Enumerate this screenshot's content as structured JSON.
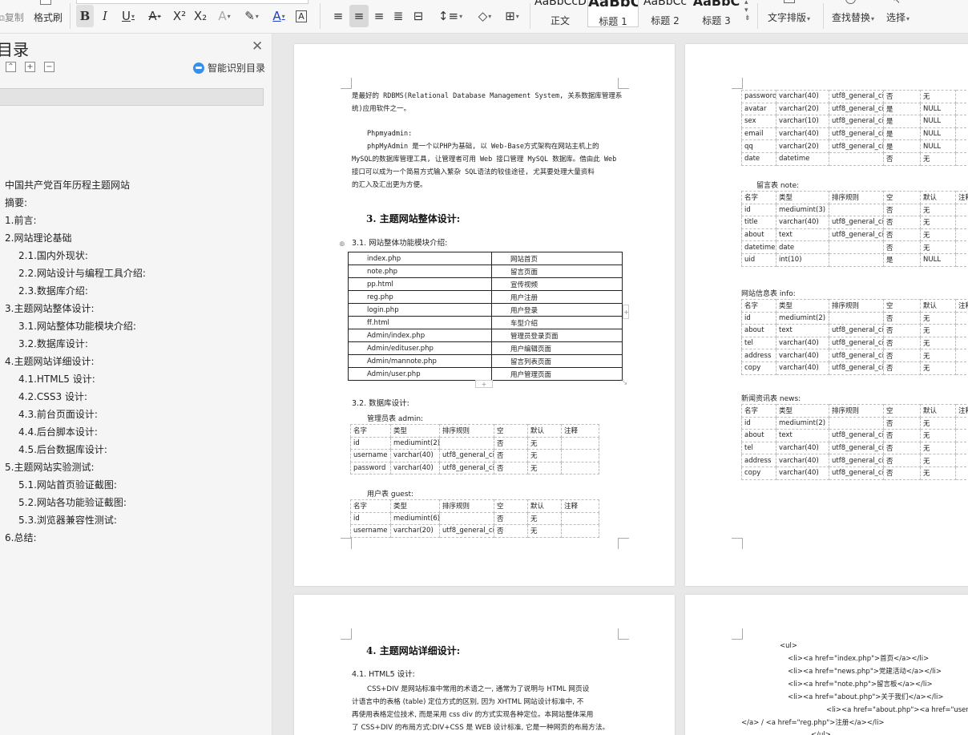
{
  "ribbon": {
    "copy": "复制",
    "format_painter": "格式刷",
    "styles": [
      {
        "preview": "AaBbCcD",
        "label": "正文"
      },
      {
        "preview": "AaBbC",
        "label": "标题 1"
      },
      {
        "preview": "AaBbCc",
        "label": "标题 2"
      },
      {
        "preview": "AaBbC",
        "label": "标题 3"
      }
    ],
    "text_layout": "文字排版",
    "find_replace": "查找替换",
    "select": "选择"
  },
  "sidebar": {
    "title": "目录",
    "smart_toc": "智能识别目录",
    "items": [
      {
        "text": "中国共产党百年历程主题网站",
        "level": 1
      },
      {
        "text": "摘要:",
        "level": 1
      },
      {
        "text": "1.前言:",
        "level": 1
      },
      {
        "text": "2.网站理论基础",
        "level": 1
      },
      {
        "text": "2.1.国内外现状:",
        "level": 2
      },
      {
        "text": "2.2.网站设计与编程工具介绍:",
        "level": 2
      },
      {
        "text": "2.3.数据库介绍:",
        "level": 2
      },
      {
        "text": "3.主题网站整体设计:",
        "level": 1
      },
      {
        "text": "3.1.网站整体功能模块介绍:",
        "level": 2
      },
      {
        "text": "3.2.数据库设计:",
        "level": 2
      },
      {
        "text": "4.主题网站详细设计:",
        "level": 1
      },
      {
        "text": "4.1.HTML5 设计:",
        "level": 2
      },
      {
        "text": "4.2.CSS3 设计:",
        "level": 2
      },
      {
        "text": "4.3.前台页面设计:",
        "level": 2
      },
      {
        "text": "4.4.后台脚本设计:",
        "level": 2
      },
      {
        "text": "4.5.后台数据库设计:",
        "level": 2
      },
      {
        "text": "5.主题网站实验测试:",
        "level": 1
      },
      {
        "text": "5.1.网站首页验证截图:",
        "level": 2
      },
      {
        "text": "5.2.网站各功能验证截图:",
        "level": 2
      },
      {
        "text": "5.3.浏览器兼容性测试:",
        "level": 2
      },
      {
        "text": "6.总结:",
        "level": 1
      }
    ]
  },
  "page1": {
    "intro_line1": "是最好的 RDBMS(Relational Database Management System, 关系数据库管理系",
    "intro_line2": "统)应用软件之一。",
    "pma_title": "Phpmyadmin:",
    "pma_line1": "phpMyAdmin 是一个以PHP为基础, 以 Web-Base方式架构在网站主机上的",
    "pma_line2": "MySQL的数据库管理工具, 让管理者可用 Web 接口管理 MySQL 数据库。借由此 Web",
    "pma_line3": "接口可以成为一个简易方式输入繁杂 SQL语法的较佳途径, 尤其要处理大量资料",
    "pma_line4": "的汇入及汇出更为方便。",
    "h_design": "3. 主题网站整体设计:",
    "h_modules": "3.1.    网站整体功能模块介绍:",
    "modules": [
      [
        "index.php",
        "网站首页"
      ],
      [
        "note.php",
        "留言页面"
      ],
      [
        "pp.html",
        "宣传视频"
      ],
      [
        "reg.php",
        "用户注册"
      ],
      [
        "login.php",
        "用户登录"
      ],
      [
        "ff.html",
        "车型介绍"
      ],
      [
        "Admin/index.php",
        "管理员登录页面"
      ],
      [
        "Admin/edituser.php",
        "用户编辑页面"
      ],
      [
        "Admin/mannote.php",
        "留言列表页面"
      ],
      [
        "Admin/user.php",
        "用户管理页面"
      ]
    ],
    "h_db": "3.2.    数据库设计:",
    "cap_admin": "管理员表 admin:",
    "admin_table": [
      [
        "名字",
        "类型",
        "排序规则",
        "空",
        "默认",
        "注释"
      ],
      [
        "id",
        "mediumint(2)",
        "",
        "否",
        "无",
        ""
      ],
      [
        "username",
        "varchar(40)",
        "utf8_general_ci",
        "否",
        "无",
        ""
      ],
      [
        "password",
        "varchar(40)",
        "utf8_general_ci",
        "否",
        "无",
        ""
      ]
    ],
    "cap_guest": "用户表 guest:",
    "guest_table": [
      [
        "名字",
        "类型",
        "排序规则",
        "空",
        "默认",
        "注释"
      ],
      [
        "id",
        "mediumint(6)",
        "",
        "否",
        "无",
        ""
      ],
      [
        "username",
        "varchar(20)",
        "utf8_general_ci",
        "否",
        "无",
        ""
      ]
    ]
  },
  "page2": {
    "guest_cont": [
      [
        "password",
        "varchar(40)",
        "utf8_general_ci",
        "否",
        "无"
      ],
      [
        "avatar",
        "varchar(20)",
        "utf8_general_ci",
        "是",
        "NULL"
      ],
      [
        "sex",
        "varchar(10)",
        "utf8_general_ci",
        "是",
        "NULL"
      ],
      [
        "email",
        "varchar(40)",
        "utf8_general_ci",
        "是",
        "NULL"
      ],
      [
        "qq",
        "varchar(20)",
        "utf8_general_ci",
        "是",
        "NULL"
      ],
      [
        "date",
        "datetime",
        "",
        "否",
        "无"
      ]
    ],
    "cap_note": "留言表 note:",
    "note_table": [
      [
        "名字",
        "类型",
        "排序规则",
        "空",
        "默认",
        "注释"
      ],
      [
        "id",
        "mediumint(3)",
        "",
        "否",
        "无",
        ""
      ],
      [
        "title",
        "varchar(40)",
        "utf8_general_ci",
        "否",
        "无",
        ""
      ],
      [
        "about",
        "text",
        "utf8_general_ci",
        "否",
        "无",
        ""
      ],
      [
        "datetime",
        "date",
        "",
        "否",
        "无",
        ""
      ],
      [
        "uid",
        "int(10)",
        "",
        "是",
        "NULL",
        ""
      ]
    ],
    "cap_info": "网站信息表 info:",
    "info_table": [
      [
        "名字",
        "类型",
        "排序规则",
        "空",
        "默认",
        "注释"
      ],
      [
        "id",
        "mediumint(2)",
        "",
        "否",
        "无",
        ""
      ],
      [
        "about",
        "text",
        "utf8_general_ci",
        "否",
        "无",
        ""
      ],
      [
        "tel",
        "varchar(40)",
        "utf8_general_ci",
        "否",
        "无",
        ""
      ],
      [
        "address",
        "varchar(40)",
        "utf8_general_ci",
        "否",
        "无",
        ""
      ],
      [
        "copy",
        "varchar(40)",
        "utf8_general_ci",
        "否",
        "无",
        ""
      ]
    ],
    "cap_news": "新闻资讯表 news:",
    "news_table": [
      [
        "名字",
        "类型",
        "排序规则",
        "空",
        "默认",
        "注释"
      ],
      [
        "id",
        "mediumint(2)",
        "",
        "否",
        "无",
        ""
      ],
      [
        "about",
        "text",
        "utf8_general_ci",
        "否",
        "无",
        ""
      ],
      [
        "tel",
        "varchar(40)",
        "utf8_general_ci",
        "否",
        "无",
        ""
      ],
      [
        "address",
        "varchar(40)",
        "utf8_general_ci",
        "否",
        "无",
        ""
      ],
      [
        "copy",
        "varchar(40)",
        "utf8_general_ci",
        "否",
        "无",
        ""
      ]
    ]
  },
  "page3": {
    "h_detail": "4. 主题网站详细设计:",
    "h_html5": "4.1.    HTML5 设计:",
    "line1": "CSS+DIV 是网站标准中常用的术语之一, 通常为了说明与 HTML 网页设",
    "line2": "计语言中的表格  (table) 定位方式的区别, 因为 XHTML 网站设计标准中, 不",
    "line3": "再使用表格定位技术, 而是采用 css div 的方式实现各种定位。本网站整体采用",
    "line4": "了 CSS+DIV 的布局方式:DIV+CSS 是 WEB 设计标准, 它是一种网页的布局方法。"
  },
  "page4": {
    "code": [
      "<ul>",
      "<li><a href=\"index.php\">首页</a></li>",
      "<li><a href=\"news.php\">党建活动</a></li>",
      "<li><a href=\"note.php\">留言板</a></li>",
      "<li><a href=\"about.php\">关于我们</a></li>",
      "<li><a href=\"about.php\"><a href=\"userlogin.p",
      "</a> / <a href=\"reg.php\">注册</a></li>",
      "</ul>"
    ]
  }
}
